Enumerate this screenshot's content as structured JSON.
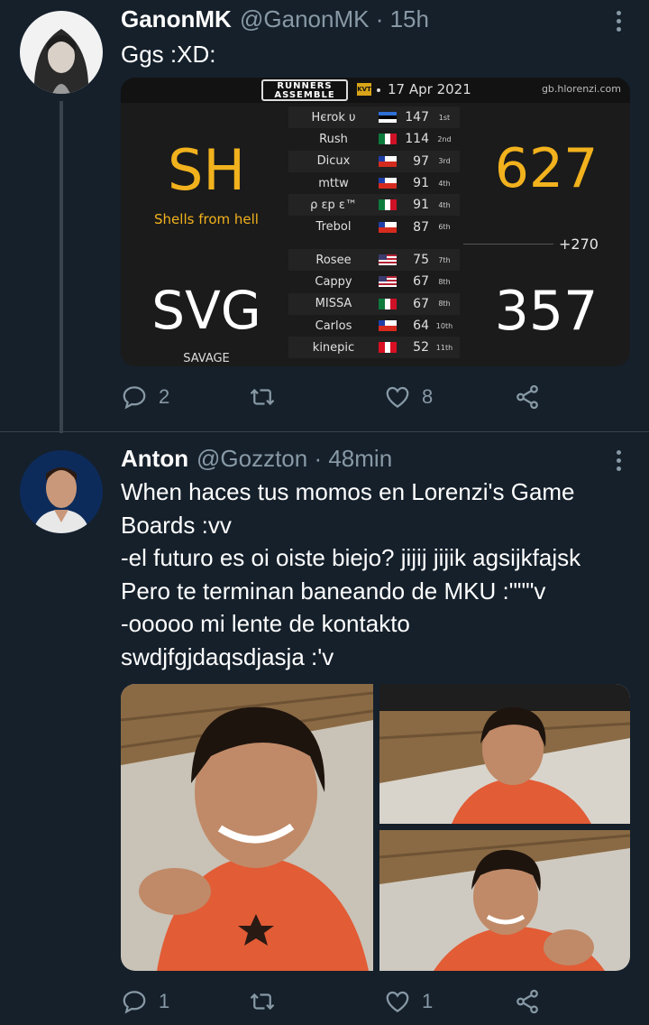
{
  "tweet1": {
    "name": "GanonMK",
    "handle": "@GanonMK",
    "time": "· 15h",
    "text": "Ggs :XD:",
    "replies": "2",
    "likes": "8"
  },
  "scoreboard": {
    "logo": "RUNNERS ASSEMBLE",
    "logo_badge": "KVT",
    "date": "17 Apr 2021",
    "site": "gb.hlorenzi.com",
    "diff": "+270",
    "teams": [
      {
        "tag": "SH",
        "full_name": "Shells from hell",
        "total": "627",
        "tag_color": "#f2b21d",
        "players": [
          {
            "name": "Hєrok υ",
            "flag": "Estonia",
            "score": "147",
            "rank": "1st"
          },
          {
            "name": "Rush",
            "flag": "Mexico",
            "score": "114",
            "rank": "2nd"
          },
          {
            "name": "Dicux",
            "flag": "Chile",
            "score": "97",
            "rank": "3rd"
          },
          {
            "name": "mttw",
            "flag": "Chile",
            "score": "91",
            "rank": "4th"
          },
          {
            "name": "ρ εр ε™",
            "flag": "Mexico",
            "score": "91",
            "rank": "4th"
          },
          {
            "name": "Trebol",
            "flag": "Chile",
            "score": "87",
            "rank": "6th"
          }
        ]
      },
      {
        "tag": "SVG",
        "full_name": "SAVAGE",
        "total": "357",
        "tag_color": "#ffffff",
        "players": [
          {
            "name": "Rosee",
            "flag": "USA",
            "score": "75",
            "rank": "7th"
          },
          {
            "name": "Cappy",
            "flag": "USA",
            "score": "67",
            "rank": "8th"
          },
          {
            "name": "MISSA",
            "flag": "Mexico",
            "score": "67",
            "rank": "8th"
          },
          {
            "name": "Carlos",
            "flag": "Chile",
            "score": "64",
            "rank": "10th"
          },
          {
            "name": "kinepic",
            "flag": "Peru",
            "score": "52",
            "rank": "11th"
          }
        ]
      }
    ]
  },
  "tweet2": {
    "name": "Anton",
    "handle": "@Gozzton",
    "time": "· 48min",
    "lines": [
      "When haces tus momos en Lorenzi's Game",
      "Boards :vv",
      "-el futuro es oi oiste biejo? jijij jijik agsijkfajsk",
      "Pero te terminan baneando de MKU :\"\"\"v",
      "-ooooo mi lente de kontakto",
      "swdjfgjdaqsdjasja :'v"
    ],
    "replies": "1",
    "likes": "1"
  },
  "colors": {
    "background": "#15202b",
    "muted": "#8899a6",
    "divider": "#38444d",
    "sh_yellow": "#f2b21d"
  },
  "icons": [
    "reply-icon",
    "retweet-icon",
    "like-icon",
    "share-icon",
    "more-icon"
  ]
}
